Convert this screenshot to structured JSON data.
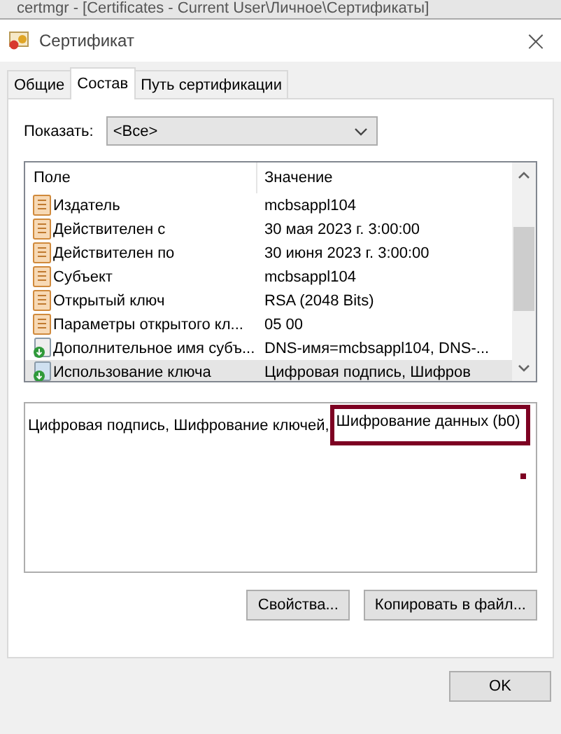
{
  "background_window": {
    "title": "certmgr - [Certificates - Current User\\Личное\\Сертификаты]"
  },
  "window": {
    "title": "Сертификат",
    "close": "×"
  },
  "tabs": [
    {
      "label": "Общие",
      "selected": false
    },
    {
      "label": "Состав",
      "selected": true
    },
    {
      "label": "Путь сертификации",
      "selected": false
    }
  ],
  "show": {
    "label": "Показать:",
    "value": "<Все>"
  },
  "fields": {
    "columns": [
      "Поле",
      "Значение"
    ],
    "rows": [
      {
        "kind": "property",
        "field": "Издатель",
        "value": "mcbsappl104",
        "selected": false
      },
      {
        "kind": "property",
        "field": "Действителен с",
        "value": "30 мая 2023 г. 3:00:00",
        "selected": false
      },
      {
        "kind": "property",
        "field": "Действителен по",
        "value": "30 июня 2023 г. 3:00:00",
        "selected": false
      },
      {
        "kind": "property",
        "field": "Субъект",
        "value": "mcbsappl104",
        "selected": false
      },
      {
        "kind": "property",
        "field": "Открытый ключ",
        "value": "RSA (2048 Bits)",
        "selected": false
      },
      {
        "kind": "property",
        "field": "Параметры открытого кл...",
        "value": "05 00",
        "selected": false
      },
      {
        "kind": "extension",
        "field": "Дополнительное имя субъ...",
        "value": "DNS-имя=mcbsappl104, DNS-...",
        "selected": false
      },
      {
        "kind": "critical_extension",
        "field": "Использование ключа",
        "value": "Цифровая подпись, Шифров",
        "selected": true
      }
    ]
  },
  "detail": {
    "text": "Цифровая подпись, Шифрование ключей,",
    "highlighted_text": "Шифрование данных (b0)"
  },
  "buttons": [
    "Свойства...",
    "Копировать в файл..."
  ],
  "ok_button": "OK"
}
